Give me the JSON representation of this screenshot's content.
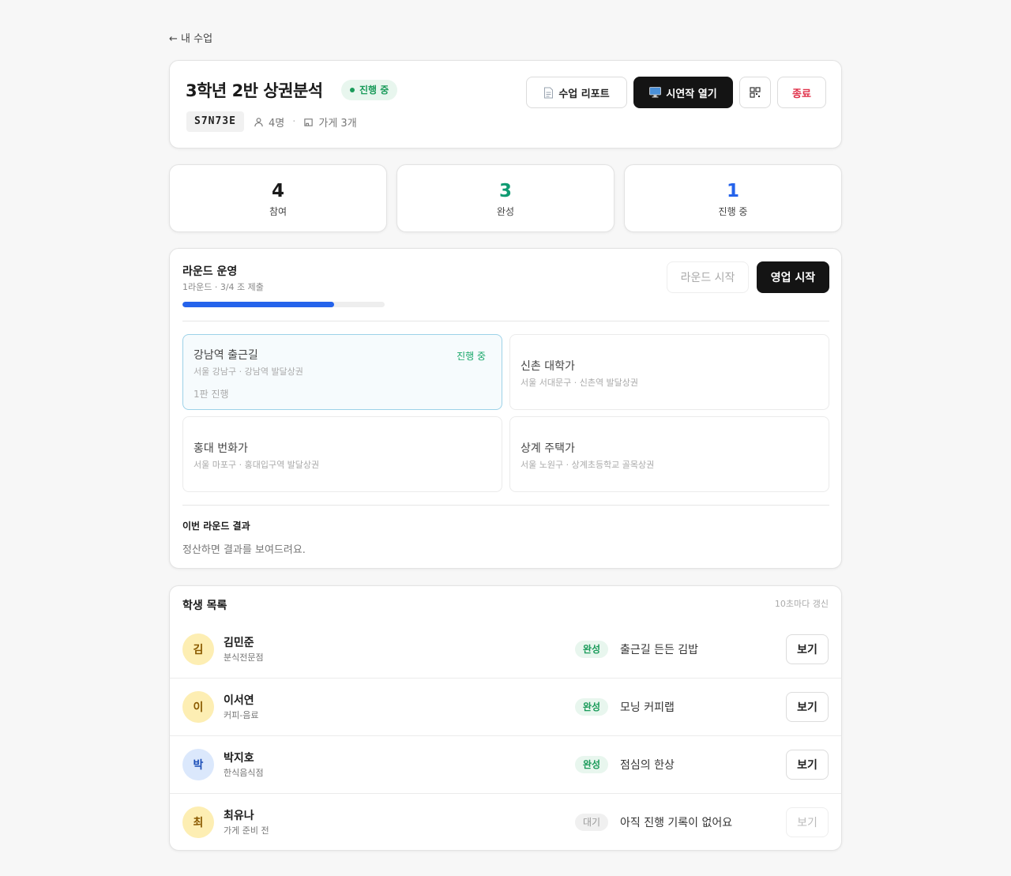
{
  "nav": {
    "back_label": "← 내 수업"
  },
  "class": {
    "title": "3학년 2반 상권분석",
    "status_badge": "진행 중",
    "code": "S7N73E",
    "students_count": "4명",
    "stores_count": "가게 3개"
  },
  "actions": {
    "report_label": "수업 리포트",
    "present_label": "시연작 열기",
    "end_label": "종료",
    "report_icon": "document-icon",
    "present_icon": "monitor-icon",
    "qr_icon": "qr-code-icon"
  },
  "stats": [
    {
      "value": "4",
      "label": "참여",
      "color": "#1a1a1a"
    },
    {
      "value": "3",
      "label": "완성",
      "color": "#0f9b72"
    },
    {
      "value": "1",
      "label": "진행 중",
      "color": "#2563eb"
    }
  ],
  "round": {
    "title": "라운드 운영",
    "subtitle": "1라운드 · 3/4 조 제출",
    "progress": 0.75,
    "start_round_label": "라운드 시작",
    "start_sales_label": "영업 시작",
    "areas": [
      {
        "name": "강남역 출근길",
        "location": "서울 강남구 · 강남역 발달상권",
        "badge": "진행 중",
        "extra": "1판 진행"
      },
      {
        "name": "신촌 대학가",
        "location": "서울 서대문구 · 신촌역 발달상권"
      },
      {
        "name": "홍대 번화가",
        "location": "서울 마포구 · 홍대입구역 발달상권"
      },
      {
        "name": "상계 주택가",
        "location": "서울 노원구 · 상계초등학교 골목상권"
      }
    ],
    "result_title": "이번 라운드 결과",
    "result_text": "정산하면 결과를 보여드려요."
  },
  "students": {
    "title": "학생 목록",
    "refresh_note": "10초마다 갱신",
    "view_label": "보기",
    "rows": [
      {
        "initial": "김",
        "name": "김민준",
        "category": "분식전문점",
        "status": "완성",
        "menu": "출근길 든든 김밥",
        "avatar_bg": "#fdeeb3",
        "avatar_fg": "#8a5a00"
      },
      {
        "initial": "이",
        "name": "이서연",
        "category": "커피-음료",
        "status": "완성",
        "menu": "모닝 커피랩",
        "avatar_bg": "#fdeeb3",
        "avatar_fg": "#8a5a00"
      },
      {
        "initial": "박",
        "name": "박지호",
        "category": "한식음식점",
        "status": "완성",
        "menu": "점심의 한상",
        "avatar_bg": "#dbe8fc",
        "avatar_fg": "#1d4fb8"
      },
      {
        "initial": "최",
        "name": "최유나",
        "category": "가게 준비 전",
        "status": "대기",
        "menu": "아직 진행 기록이 없어요",
        "avatar_bg": "#fdeeb3",
        "avatar_fg": "#8a5a00"
      }
    ]
  }
}
